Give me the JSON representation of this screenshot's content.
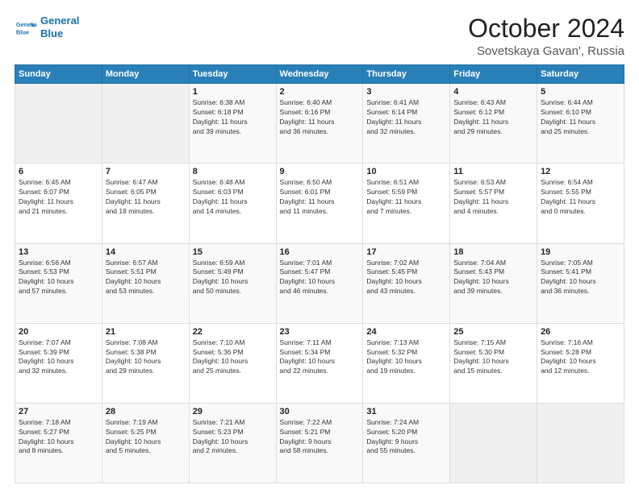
{
  "logo": {
    "line1": "General",
    "line2": "Blue"
  },
  "header": {
    "month": "October 2024",
    "location": "Sovetskaya Gavan', Russia"
  },
  "days_of_week": [
    "Sunday",
    "Monday",
    "Tuesday",
    "Wednesday",
    "Thursday",
    "Friday",
    "Saturday"
  ],
  "weeks": [
    [
      {
        "num": "",
        "info": ""
      },
      {
        "num": "",
        "info": ""
      },
      {
        "num": "1",
        "info": "Sunrise: 6:38 AM\nSunset: 6:18 PM\nDaylight: 11 hours\nand 39 minutes."
      },
      {
        "num": "2",
        "info": "Sunrise: 6:40 AM\nSunset: 6:16 PM\nDaylight: 11 hours\nand 36 minutes."
      },
      {
        "num": "3",
        "info": "Sunrise: 6:41 AM\nSunset: 6:14 PM\nDaylight: 11 hours\nand 32 minutes."
      },
      {
        "num": "4",
        "info": "Sunrise: 6:43 AM\nSunset: 6:12 PM\nDaylight: 11 hours\nand 29 minutes."
      },
      {
        "num": "5",
        "info": "Sunrise: 6:44 AM\nSunset: 6:10 PM\nDaylight: 11 hours\nand 25 minutes."
      }
    ],
    [
      {
        "num": "6",
        "info": "Sunrise: 6:45 AM\nSunset: 6:07 PM\nDaylight: 11 hours\nand 21 minutes."
      },
      {
        "num": "7",
        "info": "Sunrise: 6:47 AM\nSunset: 6:05 PM\nDaylight: 11 hours\nand 18 minutes."
      },
      {
        "num": "8",
        "info": "Sunrise: 6:48 AM\nSunset: 6:03 PM\nDaylight: 11 hours\nand 14 minutes."
      },
      {
        "num": "9",
        "info": "Sunrise: 6:50 AM\nSunset: 6:01 PM\nDaylight: 11 hours\nand 11 minutes."
      },
      {
        "num": "10",
        "info": "Sunrise: 6:51 AM\nSunset: 5:59 PM\nDaylight: 11 hours\nand 7 minutes."
      },
      {
        "num": "11",
        "info": "Sunrise: 6:53 AM\nSunset: 5:57 PM\nDaylight: 11 hours\nand 4 minutes."
      },
      {
        "num": "12",
        "info": "Sunrise: 6:54 AM\nSunset: 5:55 PM\nDaylight: 11 hours\nand 0 minutes."
      }
    ],
    [
      {
        "num": "13",
        "info": "Sunrise: 6:56 AM\nSunset: 5:53 PM\nDaylight: 10 hours\nand 57 minutes."
      },
      {
        "num": "14",
        "info": "Sunrise: 6:57 AM\nSunset: 5:51 PM\nDaylight: 10 hours\nand 53 minutes."
      },
      {
        "num": "15",
        "info": "Sunrise: 6:59 AM\nSunset: 5:49 PM\nDaylight: 10 hours\nand 50 minutes."
      },
      {
        "num": "16",
        "info": "Sunrise: 7:01 AM\nSunset: 5:47 PM\nDaylight: 10 hours\nand 46 minutes."
      },
      {
        "num": "17",
        "info": "Sunrise: 7:02 AM\nSunset: 5:45 PM\nDaylight: 10 hours\nand 43 minutes."
      },
      {
        "num": "18",
        "info": "Sunrise: 7:04 AM\nSunset: 5:43 PM\nDaylight: 10 hours\nand 39 minutes."
      },
      {
        "num": "19",
        "info": "Sunrise: 7:05 AM\nSunset: 5:41 PM\nDaylight: 10 hours\nand 36 minutes."
      }
    ],
    [
      {
        "num": "20",
        "info": "Sunrise: 7:07 AM\nSunset: 5:39 PM\nDaylight: 10 hours\nand 32 minutes."
      },
      {
        "num": "21",
        "info": "Sunrise: 7:08 AM\nSunset: 5:38 PM\nDaylight: 10 hours\nand 29 minutes."
      },
      {
        "num": "22",
        "info": "Sunrise: 7:10 AM\nSunset: 5:36 PM\nDaylight: 10 hours\nand 25 minutes."
      },
      {
        "num": "23",
        "info": "Sunrise: 7:11 AM\nSunset: 5:34 PM\nDaylight: 10 hours\nand 22 minutes."
      },
      {
        "num": "24",
        "info": "Sunrise: 7:13 AM\nSunset: 5:32 PM\nDaylight: 10 hours\nand 19 minutes."
      },
      {
        "num": "25",
        "info": "Sunrise: 7:15 AM\nSunset: 5:30 PM\nDaylight: 10 hours\nand 15 minutes."
      },
      {
        "num": "26",
        "info": "Sunrise: 7:16 AM\nSunset: 5:28 PM\nDaylight: 10 hours\nand 12 minutes."
      }
    ],
    [
      {
        "num": "27",
        "info": "Sunrise: 7:18 AM\nSunset: 5:27 PM\nDaylight: 10 hours\nand 8 minutes."
      },
      {
        "num": "28",
        "info": "Sunrise: 7:19 AM\nSunset: 5:25 PM\nDaylight: 10 hours\nand 5 minutes."
      },
      {
        "num": "29",
        "info": "Sunrise: 7:21 AM\nSunset: 5:23 PM\nDaylight: 10 hours\nand 2 minutes."
      },
      {
        "num": "30",
        "info": "Sunrise: 7:22 AM\nSunset: 5:21 PM\nDaylight: 9 hours\nand 58 minutes."
      },
      {
        "num": "31",
        "info": "Sunrise: 7:24 AM\nSunset: 5:20 PM\nDaylight: 9 hours\nand 55 minutes."
      },
      {
        "num": "",
        "info": ""
      },
      {
        "num": "",
        "info": ""
      }
    ]
  ]
}
